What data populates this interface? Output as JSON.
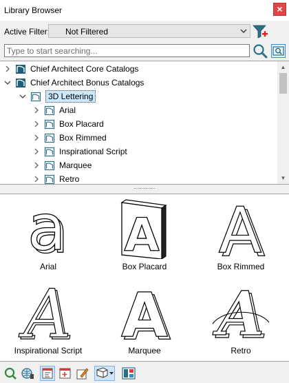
{
  "window": {
    "title": "Library Browser",
    "close_label": "×"
  },
  "filter": {
    "label": "Active Filter:",
    "value": "Not Filtered"
  },
  "search": {
    "placeholder": "Type to start searching..."
  },
  "tree": {
    "rows": [
      {
        "label": "Chief Architect Core Catalogs",
        "expanded": false,
        "level": 0,
        "icon": "catalog-icon"
      },
      {
        "label": "Chief Architect Bonus Catalogs",
        "expanded": true,
        "level": 0,
        "icon": "catalog-icon"
      },
      {
        "label": "3D Lettering",
        "expanded": true,
        "level": 1,
        "selected": true,
        "icon": "folder-icon"
      },
      {
        "label": "Arial",
        "expanded": false,
        "level": 2,
        "icon": "folder-icon"
      },
      {
        "label": "Box Placard",
        "expanded": false,
        "level": 2,
        "icon": "folder-icon"
      },
      {
        "label": "Box Rimmed",
        "expanded": false,
        "level": 2,
        "icon": "folder-icon"
      },
      {
        "label": "Inspirational Script",
        "expanded": false,
        "level": 2,
        "icon": "folder-icon"
      },
      {
        "label": "Marquee",
        "expanded": false,
        "level": 2,
        "icon": "folder-icon"
      },
      {
        "label": "Retro",
        "expanded": false,
        "level": 2,
        "icon": "folder-icon"
      }
    ]
  },
  "preview": {
    "items": [
      {
        "label": "Arial",
        "glyph": "a"
      },
      {
        "label": "Box Placard",
        "glyph": "A"
      },
      {
        "label": "Box Rimmed",
        "glyph": "A"
      },
      {
        "label": "Inspirational Script",
        "glyph": "A"
      },
      {
        "label": "Marquee",
        "glyph": "A"
      },
      {
        "label": "Retro",
        "glyph": "A"
      }
    ]
  },
  "toolbar": {
    "buttons": [
      "zoom-icon",
      "globe-pin-icon",
      "tree-view-icon",
      "add-folder-icon",
      "edit-icon",
      "hide-filter-icon",
      "preview-icon"
    ]
  },
  "colors": {
    "selection": "#cce8ff",
    "accent": "#3c8bd1",
    "icon_teal": "#2a6f86"
  }
}
